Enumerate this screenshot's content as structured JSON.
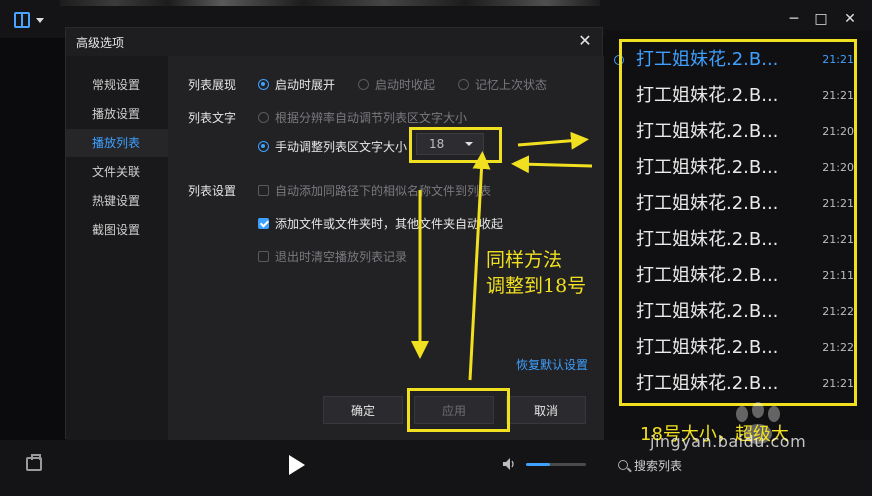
{
  "window_controls": {
    "minimize": "─",
    "maximize": "□",
    "close": "✕"
  },
  "dialog": {
    "title": "高级选项",
    "close_glyph": "✕",
    "nav": [
      {
        "label": "常规设置"
      },
      {
        "label": "播放设置"
      },
      {
        "label": "播放列表"
      },
      {
        "label": "文件关联"
      },
      {
        "label": "热键设置"
      },
      {
        "label": "截图设置"
      }
    ],
    "active_nav_index": 2,
    "sections": {
      "display_label": "列表展现",
      "display_options": [
        "启动时展开",
        "启动时收起",
        "记忆上次状态"
      ],
      "display_selected_index": 0,
      "text_label": "列表文字",
      "text_auto_option": "根据分辨率自动调节列表区文字大小",
      "text_manual_option": "手动调整列表区文字大小",
      "text_manual_selected": true,
      "font_size_value": "18",
      "settings_label": "列表设置",
      "settings_options": [
        {
          "label": "自动添加同路径下的相似名称文件到列表",
          "checked": false
        },
        {
          "label": "添加文件或文件夹时，其他文件夹自动收起",
          "checked": true
        },
        {
          "label": "退出时清空播放列表记录",
          "checked": false
        }
      ]
    },
    "restore_defaults": "恢复默认设置",
    "buttons": {
      "ok": "确定",
      "apply": "应用",
      "cancel": "取消"
    }
  },
  "playlist": {
    "items": [
      {
        "title": "打工姐妹花.2.B...",
        "time": "21:21",
        "active": true
      },
      {
        "title": "打工姐妹花.2.B...",
        "time": "21:21",
        "active": false
      },
      {
        "title": "打工姐妹花.2.B...",
        "time": "21:20",
        "active": false
      },
      {
        "title": "打工姐妹花.2.B...",
        "time": "21:20",
        "active": false
      },
      {
        "title": "打工姐妹花.2.B...",
        "time": "21:21",
        "active": false
      },
      {
        "title": "打工姐妹花.2.B...",
        "time": "21:21",
        "active": false
      },
      {
        "title": "打工姐妹花.2.B...",
        "time": "21:11",
        "active": false
      },
      {
        "title": "打工姐妹花.2.B...",
        "time": "21:22",
        "active": false
      },
      {
        "title": "打工姐妹花.2.B...",
        "time": "21:22",
        "active": false
      },
      {
        "title": "打工姐妹花.2.B...",
        "time": "21:21",
        "active": false
      }
    ]
  },
  "bottom_bar": {
    "search_label": "搜索列表",
    "volume_level": 0.4
  },
  "annotations": {
    "instruction_line1": "同样方法",
    "instruction_line2": "调整到18号",
    "size_caption": "18号大小，超级大",
    "watermark": "jingyan.baidu.com",
    "highlight_color": "#f0e020"
  },
  "colors": {
    "accent": "#3ea0ff",
    "background": "#0b0b0d",
    "dialog_bg": "#1e1e20"
  }
}
